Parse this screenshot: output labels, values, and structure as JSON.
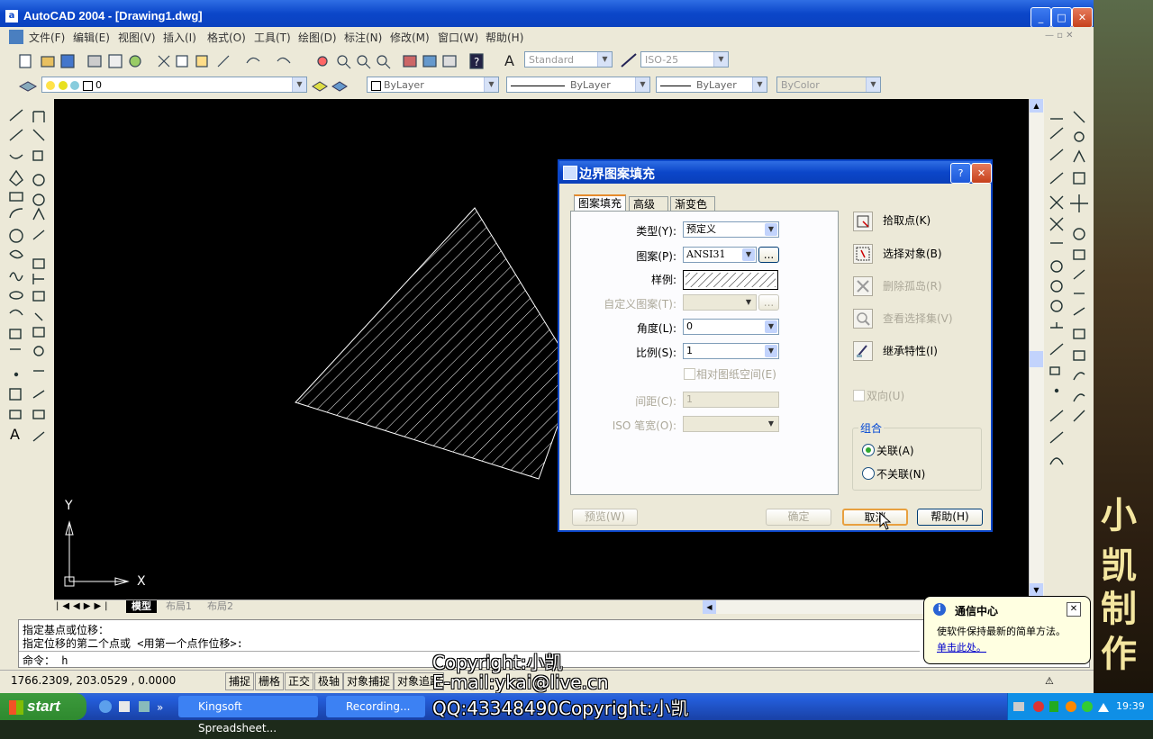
{
  "window": {
    "title": "AutoCAD 2004 - [Drawing1.dwg]"
  },
  "menu": [
    "文件(F)",
    "编辑(E)",
    "视图(V)",
    "插入(I)",
    "格式(O)",
    "工具(T)",
    "绘图(D)",
    "标注(N)",
    "修改(M)",
    "窗口(W)",
    "帮助(H)"
  ],
  "toolbar": {
    "text_style": "Standard",
    "dim_style": "ISO-25",
    "layer": "0",
    "color": "ByLayer",
    "linetype": "ByLayer",
    "lineweight": "ByLayer",
    "plotstyle": "ByColor"
  },
  "layout_tabs": [
    "模型",
    "布局1",
    "布局2"
  ],
  "command": {
    "lines": [
      "指定基点或位移：",
      "指定位移的第二个点或 <用第一个点作位移>:"
    ],
    "prompt": "命令： h"
  },
  "status": {
    "coords": "1766.2309, 203.0529 , 0.0000",
    "buttons": [
      "捕捉",
      "栅格",
      "正交",
      "极轴",
      "对象捕捉",
      "对象追踪"
    ]
  },
  "ucs": {
    "x": "X",
    "y": "Y"
  },
  "dialog": {
    "title": "边界图案填充",
    "tabs": [
      "图案填充",
      "高级",
      "渐变色"
    ],
    "type_label": "类型(Y):",
    "type_value": "预定义",
    "pattern_label": "图案(P):",
    "pattern_value": "ANSI31",
    "pattern_browse": "...",
    "swatch_label": "样例:",
    "custom_label": "自定义图案(T):",
    "angle_label": "角度(L):",
    "angle_value": "0",
    "scale_label": "比例(S):",
    "scale_value": "1",
    "relative_label": "相对图纸空间(E)",
    "spacing_label": "间距(C):",
    "spacing_value": "1",
    "iso_label": "ISO 笔宽(O):",
    "pick_points": "拾取点(K)",
    "select_objects": "选择对象(B)",
    "remove_islands": "删除孤岛(R)",
    "view_selections": "查看选择集(V)",
    "inherit": "继承特性(I)",
    "double": "双向(U)",
    "group_label": "组合",
    "associative": "关联(A)",
    "nonassociative": "不关联(N)",
    "preview": "预览(W)",
    "ok": "确定",
    "cancel": "取消",
    "help": "帮助(H)"
  },
  "balloon": {
    "title": "通信中心",
    "text": "使软件保持最新的简单方法。",
    "link": "单击此处。"
  },
  "watermark": {
    "line1": "Copyright:小凯",
    "line2": "E-mail:ykai@live.cn",
    "line3": "QQ:43348490Copyright:小凯"
  },
  "brand": [
    "小",
    "凯",
    "制",
    "作"
  ],
  "taskbar": {
    "start": "start",
    "items": [
      "Kingsoft Spreadsheet...",
      "Recording..."
    ],
    "clock": "19:39"
  },
  "colors": {
    "title_blue": "#0b46c9",
    "canvas": "#000000",
    "taskbar": "#245edb"
  }
}
